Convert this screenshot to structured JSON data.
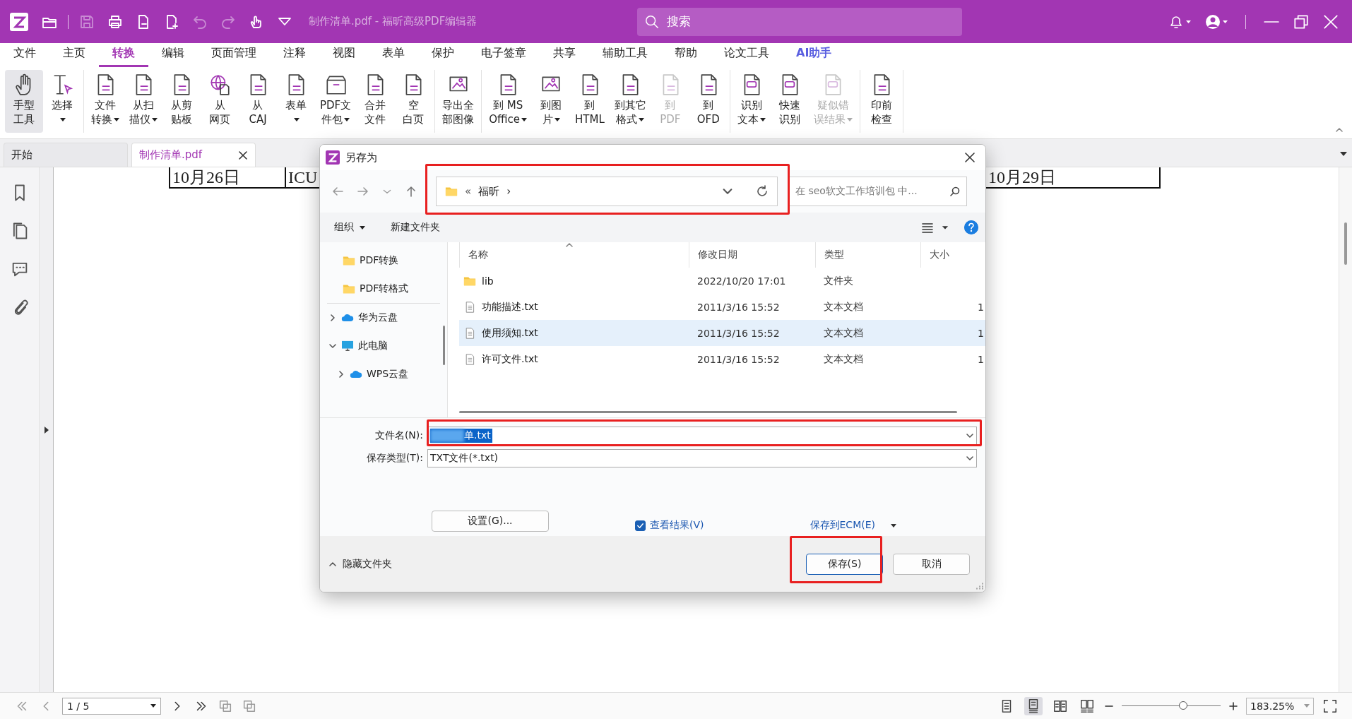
{
  "title_bar": {
    "title": "制作清单.pdf - 福昕高级PDF编辑器",
    "search": {
      "placeholder": "搜索"
    }
  },
  "quick_tools": [
    {
      "kind": "open",
      "disabled": false
    },
    {
      "kind": "save",
      "disabled": true
    },
    {
      "kind": "print",
      "disabled": false
    },
    {
      "kind": "export",
      "disabled": false
    },
    {
      "kind": "new",
      "disabled": false
    },
    {
      "kind": "undo",
      "disabled": true
    },
    {
      "kind": "redo",
      "disabled": true
    },
    {
      "kind": "touch",
      "disabled": false
    },
    {
      "kind": "customize",
      "disabled": false
    }
  ],
  "menu_tabs": [
    {
      "label": "文件",
      "selected": false,
      "kind": "plain"
    },
    {
      "label": "主页",
      "selected": false,
      "kind": "plain"
    },
    {
      "label": "转换",
      "selected": true,
      "kind": "plain"
    },
    {
      "label": "编辑",
      "selected": false,
      "kind": "plain"
    },
    {
      "label": "页面管理",
      "selected": false,
      "kind": "plain"
    },
    {
      "label": "注释",
      "selected": false,
      "kind": "plain"
    },
    {
      "label": "视图",
      "selected": false,
      "kind": "plain"
    },
    {
      "label": "表单",
      "selected": false,
      "kind": "plain"
    },
    {
      "label": "保护",
      "selected": false,
      "kind": "plain"
    },
    {
      "label": "电子签章",
      "selected": false,
      "kind": "plain"
    },
    {
      "label": "共享",
      "selected": false,
      "kind": "plain"
    },
    {
      "label": "辅助工具",
      "selected": false,
      "kind": "plain"
    },
    {
      "label": "帮助",
      "selected": false,
      "kind": "plain"
    },
    {
      "label": "论文工具",
      "selected": false,
      "kind": "plain"
    },
    {
      "label": "AI助手",
      "selected": false,
      "kind": "ai"
    }
  ],
  "ribbon_groups": [
    [
      {
        "lines": [
          "手型",
          "工具"
        ],
        "dropdown": false,
        "disabled": false,
        "selected": true,
        "kind": "hand"
      },
      {
        "lines": [
          "选择"
        ],
        "dropdown": true,
        "disabled": false,
        "selected": false,
        "kind": "select"
      }
    ],
    [
      {
        "lines": [
          "文件",
          "转换"
        ],
        "dropdown": true,
        "disabled": false,
        "selected": false,
        "kind": "doc"
      },
      {
        "lines": [
          "从扫",
          "描仪"
        ],
        "dropdown": true,
        "disabled": false,
        "selected": false,
        "kind": "doc"
      },
      {
        "lines": [
          "从剪",
          "贴板"
        ],
        "dropdown": false,
        "disabled": false,
        "selected": false,
        "kind": "doc"
      },
      {
        "lines": [
          "从",
          "网页"
        ],
        "dropdown": false,
        "disabled": false,
        "selected": false,
        "kind": "globe"
      },
      {
        "lines": [
          "从",
          "CAJ"
        ],
        "dropdown": false,
        "disabled": false,
        "selected": false,
        "kind": "doc"
      },
      {
        "lines": [
          "表单"
        ],
        "dropdown": true,
        "disabled": false,
        "selected": false,
        "kind": "doc"
      },
      {
        "lines": [
          "PDF文",
          "件包"
        ],
        "dropdown": true,
        "disabled": false,
        "selected": false,
        "kind": "folder"
      },
      {
        "lines": [
          "合并",
          "文件"
        ],
        "dropdown": false,
        "disabled": false,
        "selected": false,
        "kind": "doc"
      },
      {
        "lines": [
          "空",
          "白页"
        ],
        "dropdown": false,
        "disabled": false,
        "selected": false,
        "kind": "doc"
      }
    ],
    [
      {
        "lines": [
          "导出全",
          "部图像"
        ],
        "dropdown": false,
        "disabled": false,
        "selected": false,
        "kind": "image"
      }
    ],
    [
      {
        "lines": [
          "到 MS",
          "Office"
        ],
        "dropdown": true,
        "disabled": false,
        "selected": false,
        "kind": "doc"
      },
      {
        "lines": [
          "到图",
          "片"
        ],
        "dropdown": true,
        "disabled": false,
        "selected": false,
        "kind": "image"
      },
      {
        "lines": [
          "到",
          "HTML"
        ],
        "dropdown": false,
        "disabled": false,
        "selected": false,
        "kind": "doc"
      },
      {
        "lines": [
          "到其它",
          "格式"
        ],
        "dropdown": true,
        "disabled": false,
        "selected": false,
        "kind": "doc"
      },
      {
        "lines": [
          "到",
          "PDF"
        ],
        "dropdown": false,
        "disabled": true,
        "selected": false,
        "kind": "doc"
      },
      {
        "lines": [
          "到",
          "OFD"
        ],
        "dropdown": false,
        "disabled": false,
        "selected": false,
        "kind": "doc"
      }
    ],
    [
      {
        "lines": [
          "识别",
          "文本"
        ],
        "dropdown": true,
        "disabled": false,
        "selected": false,
        "kind": "ocr"
      },
      {
        "lines": [
          "快速",
          "识别"
        ],
        "dropdown": false,
        "disabled": false,
        "selected": false,
        "kind": "ocr"
      },
      {
        "lines": [
          "疑似错",
          "误结果"
        ],
        "dropdown": true,
        "disabled": true,
        "selected": false,
        "kind": "ocr"
      }
    ],
    [
      {
        "lines": [
          "印前",
          "检查"
        ],
        "dropdown": false,
        "disabled": false,
        "selected": false,
        "kind": "doc"
      }
    ]
  ],
  "doc_tabs": [
    {
      "label": "开始",
      "selected": false,
      "closable": false
    },
    {
      "label": "制作清单.pdf",
      "selected": true,
      "closable": true
    }
  ],
  "sidebar_icons": [
    {
      "kind": "bookmark"
    },
    {
      "kind": "pages"
    },
    {
      "kind": "comment"
    },
    {
      "kind": "attachment"
    }
  ],
  "document": {
    "cells": [
      "10月26日",
      "ICU",
      "10月29日"
    ]
  },
  "dialog": {
    "title": "另存为",
    "path": {
      "prefix": "«",
      "folder": "福昕",
      "separator": "›"
    },
    "search": {
      "placeholder": "在 seo软文工作培训包 中..."
    },
    "toolbar": {
      "organize": "组织",
      "new_folder": "新建文件夹"
    },
    "quick_access": [
      {
        "label": "PDF转换",
        "kind": "folder"
      },
      {
        "label": "PDF转格式",
        "kind": "folder"
      }
    ],
    "tree": [
      {
        "label": "华为云盘",
        "kind": "cloud",
        "expanded": false
      },
      {
        "label": "此电脑",
        "kind": "computer",
        "expanded": true,
        "children": [
          {
            "label": "WPS云盘",
            "kind": "cloud",
            "expanded": false
          }
        ]
      }
    ],
    "columns": [
      "名称",
      "修改日期",
      "类型",
      "大小"
    ],
    "files": [
      {
        "name": "lib",
        "date": "2022/10/20 17:01",
        "type": "文件夹",
        "kind": "folder",
        "selected": false
      },
      {
        "name": "功能描述.txt",
        "date": "2011/3/16 15:52",
        "type": "文本文档",
        "size": "1",
        "kind": "text",
        "selected": false
      },
      {
        "name": "使用须知.txt",
        "date": "2011/3/16 15:52",
        "type": "文本文档",
        "size": "1",
        "kind": "text",
        "selected": true
      },
      {
        "name": "许可文件.txt",
        "date": "2011/3/16 15:52",
        "type": "文本文档",
        "size": "1",
        "kind": "text",
        "selected": false
      }
    ],
    "file_name": {
      "label": "文件名(N):",
      "value": "单.txt"
    },
    "file_type": {
      "label": "保存类型(T):",
      "value": "TXT文件(*.txt)"
    },
    "settings_button": "设置(G)...",
    "view_result": {
      "label": "查看结果(V)",
      "checked": true
    },
    "ecm_link": "保存到ECM(E)",
    "hide_folders": "隐藏文件夹",
    "buttons": [
      {
        "label": "保存(S)",
        "kind": "primary"
      },
      {
        "label": "取消",
        "kind": "secondary"
      }
    ]
  },
  "status_bar": {
    "page": "1 / 5",
    "zoom": "183.25%",
    "zoom_slider": {
      "level": 0.62
    },
    "view_modes": [
      {
        "kind": "single",
        "selected": false
      },
      {
        "kind": "continuous",
        "selected": true
      },
      {
        "kind": "facing",
        "selected": false
      },
      {
        "kind": "facing_continuous",
        "selected": false
      }
    ]
  }
}
